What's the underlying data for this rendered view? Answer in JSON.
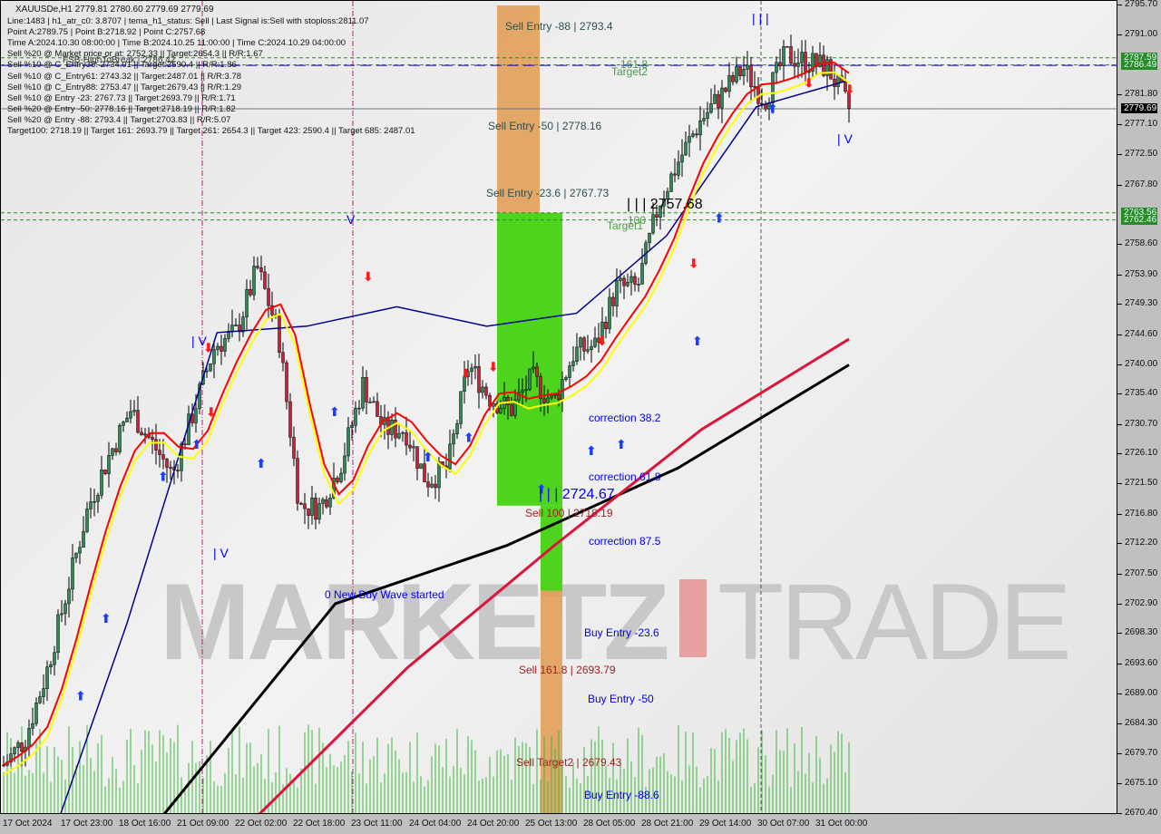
{
  "header": {
    "title": "XAUUSDe,H1  2779.81 2780.60 2779.69 2779.69",
    "lines": [
      "Line:1483 | h1_atr_c0: 3.8707 | tema_h1_status: Sell | Last Signal is:Sell with stoploss:2811.07",
      "Point A:2789.75 | Point B:2718.92 | Point C:2757.68",
      "Time A:2024.10.30 08:00:00 | Time B:2024.10.25 11:00:00 | Time C:2024.10.29 04:00:00",
      "Sell %20 @ Market price or at: 2752.33 || Target:2654.3 || R/R:1.67",
      "Sell %10 @ C_Entry38: 2734.01 || Target:2590.4 || R/R:1.86",
      "Sell %10 @ C_Entry61: 2743.32 || Target:2487.01 || R/R:3.78",
      "Sell %10 @ C_Entry88: 2753.47 || Target:2679.43 || R/R:1.29",
      "Sell %10 @ Entry -23: 2767.73 || Target:2693.79 || R/R:1.71",
      "Sell %20 @ Entry -50: 2778.16 || Target:2718.19 || R/R:1.82",
      "Sell %20 @ Entry -88: 2793.4 || Target:2703.83 || R/R:5.07",
      "Target100: 2718.19 || Target 161: 2693.79 || Target 261: 2654.3 || Target 423: 2590.4 || Target 685: 2487.01"
    ]
  },
  "watermark": {
    "left": "MARKETZ",
    "right": "TRADE"
  },
  "labels": {
    "fsb": "FSB-HighToBreak | 2786.42",
    "sell_entry_88": "Sell Entry -88 | 2793.4",
    "level_1618": "161.8",
    "target2": "Target2",
    "sell_entry_50": "Sell Entry -50 | 2778.16",
    "sell_entry_236": "Sell Entry -23.6 | 2767.73",
    "point_c": "| | | 2757.68",
    "level_100": "100",
    "target1": "Target1",
    "corr382": "correction 38.2",
    "corr618": "correction 61.8",
    "corr875": "correction 87.5",
    "point_b": "| | | 2724.67",
    "sell100": "Sell 100 | 2718.19",
    "new_buy": "0 New Buy Wave started",
    "buy_236": "Buy Entry -23.6",
    "sell1618": "Sell 161.8 | 2693.79",
    "buy_50": "Buy Entry -50",
    "sell_t2": "Sell Target2 | 2679.43",
    "buy_886": "Buy Entry -88.6",
    "top_marks": "| | |",
    "iv1": "| V",
    "iv2": "| V",
    "iv3": "| V",
    "v1": "V"
  },
  "colors": {
    "zone_sell": "#e09a50",
    "zone_buy": "#4fd41e",
    "ma_fast": "#ff0000",
    "ma_yellow": "#ffff00",
    "ma_blue": "#00008b",
    "ma_crimson": "#dc143c",
    "ma_black": "#000000",
    "level": "#2a8a2a",
    "volume": "#3cb83c",
    "bull": "#2e8b57",
    "bear": "#cc2233"
  },
  "chart_data": {
    "type": "candlestick",
    "symbol": "XAUUSDe",
    "timeframe": "H1",
    "ylim": [
      2670.4,
      2795.7
    ],
    "y_ticks": [
      "2795.70",
      "2791.00",
      "2781.80",
      "2777.10",
      "2772.50",
      "2767.80",
      "2758.60",
      "2753.90",
      "2749.30",
      "2744.60",
      "2740.00",
      "2735.40",
      "2730.70",
      "2726.10",
      "2721.50",
      "2716.80",
      "2712.20",
      "2707.50",
      "2702.90",
      "2698.30",
      "2693.60",
      "2689.00",
      "2684.30",
      "2679.70",
      "2675.10",
      "2670.40"
    ],
    "x_ticks": [
      "17 Oct 2024",
      "17 Oct 23:00",
      "18 Oct 16:00",
      "21 Oct 09:00",
      "22 Oct 02:00",
      "22 Oct 18:00",
      "23 Oct 11:00",
      "24 Oct 04:00",
      "24 Oct 20:00",
      "25 Oct 13:00",
      "28 Oct 05:00",
      "28 Oct 21:00",
      "29 Oct 14:00",
      "30 Oct 07:00",
      "31 Oct 00:00"
    ],
    "price_boxes": [
      {
        "value": "2787.59",
        "color": "#2a8a2a"
      },
      {
        "value": "2786.49",
        "color": "#2a8a2a"
      },
      {
        "value": "2779.69",
        "color": "#000000"
      },
      {
        "value": "2763.56",
        "color": "#2a8a2a"
      },
      {
        "value": "2762.46",
        "color": "#2a8a2a"
      }
    ],
    "close_path": [
      2678,
      2682,
      2692,
      2705,
      2718,
      2726,
      2733,
      2728,
      2723,
      2733,
      2743,
      2745,
      2755,
      2745,
      2718,
      2718,
      2725,
      2737,
      2730,
      2730,
      2722,
      2724,
      2740,
      2735,
      2733,
      2738,
      2734,
      2742,
      2743,
      2752,
      2752,
      2765,
      2772,
      2778,
      2782,
      2786,
      2781,
      2788,
      2787,
      2786,
      2779.69
    ],
    "ma_blue": [
      2660,
      2700,
      2745,
      2746,
      2749,
      2746,
      2748,
      2760,
      2780,
      2784
    ],
    "ma_black": [
      2670.4,
      2703,
      2712,
      2724,
      2740
    ],
    "ma_crimson": [
      2670.4,
      2693,
      2712,
      2730,
      2744
    ]
  }
}
